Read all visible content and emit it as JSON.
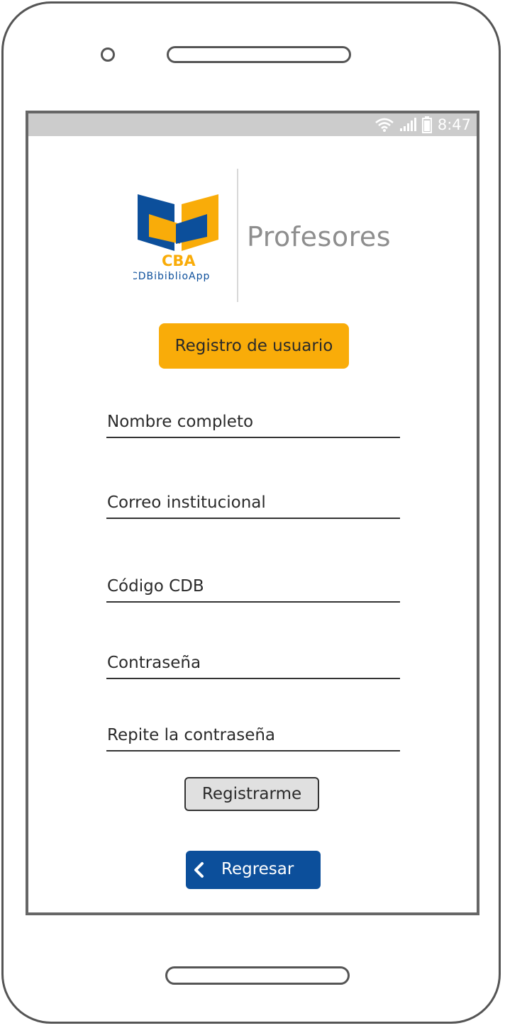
{
  "status_bar": {
    "time": "8:47",
    "icons": [
      "wifi-icon",
      "signal-icon",
      "battery-icon"
    ]
  },
  "brand": {
    "logo_text": "CBA",
    "logo_subtext": "CDBibiblioApp",
    "title": "Profesores"
  },
  "form": {
    "header": "Registro de usuario",
    "fields": [
      {
        "label": "Nombre completo"
      },
      {
        "label": "Correo institucional"
      },
      {
        "label": "Código CDB"
      },
      {
        "label": "Contraseña"
      },
      {
        "label": "Repite la contraseña"
      }
    ],
    "submit_label": "Registrarme",
    "back_label": "Regresar"
  },
  "colors": {
    "accent_orange": "#f9ac09",
    "brand_blue": "#0c4f9b",
    "status_bar": "#cccccc"
  }
}
